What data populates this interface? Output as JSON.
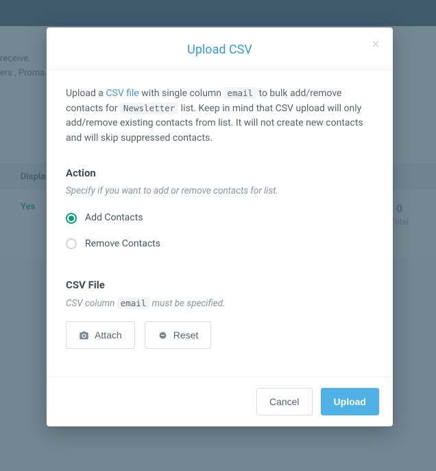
{
  "background": {
    "line1": "receive.",
    "line2": "ers , Proma",
    "header_col": "Displa",
    "yes": "Yes",
    "total_num": "0",
    "total_label": "Total"
  },
  "modal": {
    "title": "Upload CSV",
    "desc": {
      "p1a": "Upload a ",
      "link": "CSV file",
      "p1b": " with single column ",
      "code1": "email",
      "p1c": " to bulk add/remove contacts for ",
      "code2": "Newsletter",
      "p1d": " list. Keep in mind that CSV upload will only add/remove existing contacts from list. It will not create new contacts and will skip suppressed contacts."
    },
    "action": {
      "title": "Action",
      "sub": "Specify if you want to add or remove contacts for list.",
      "opt1": "Add Contacts",
      "opt2": "Remove Contacts"
    },
    "csv": {
      "title": "CSV File",
      "sub_a": "CSV column ",
      "sub_code": "email",
      "sub_b": " must be specified."
    },
    "buttons": {
      "attach": "Attach",
      "reset": "Reset",
      "cancel": "Cancel",
      "upload": "Upload"
    }
  }
}
